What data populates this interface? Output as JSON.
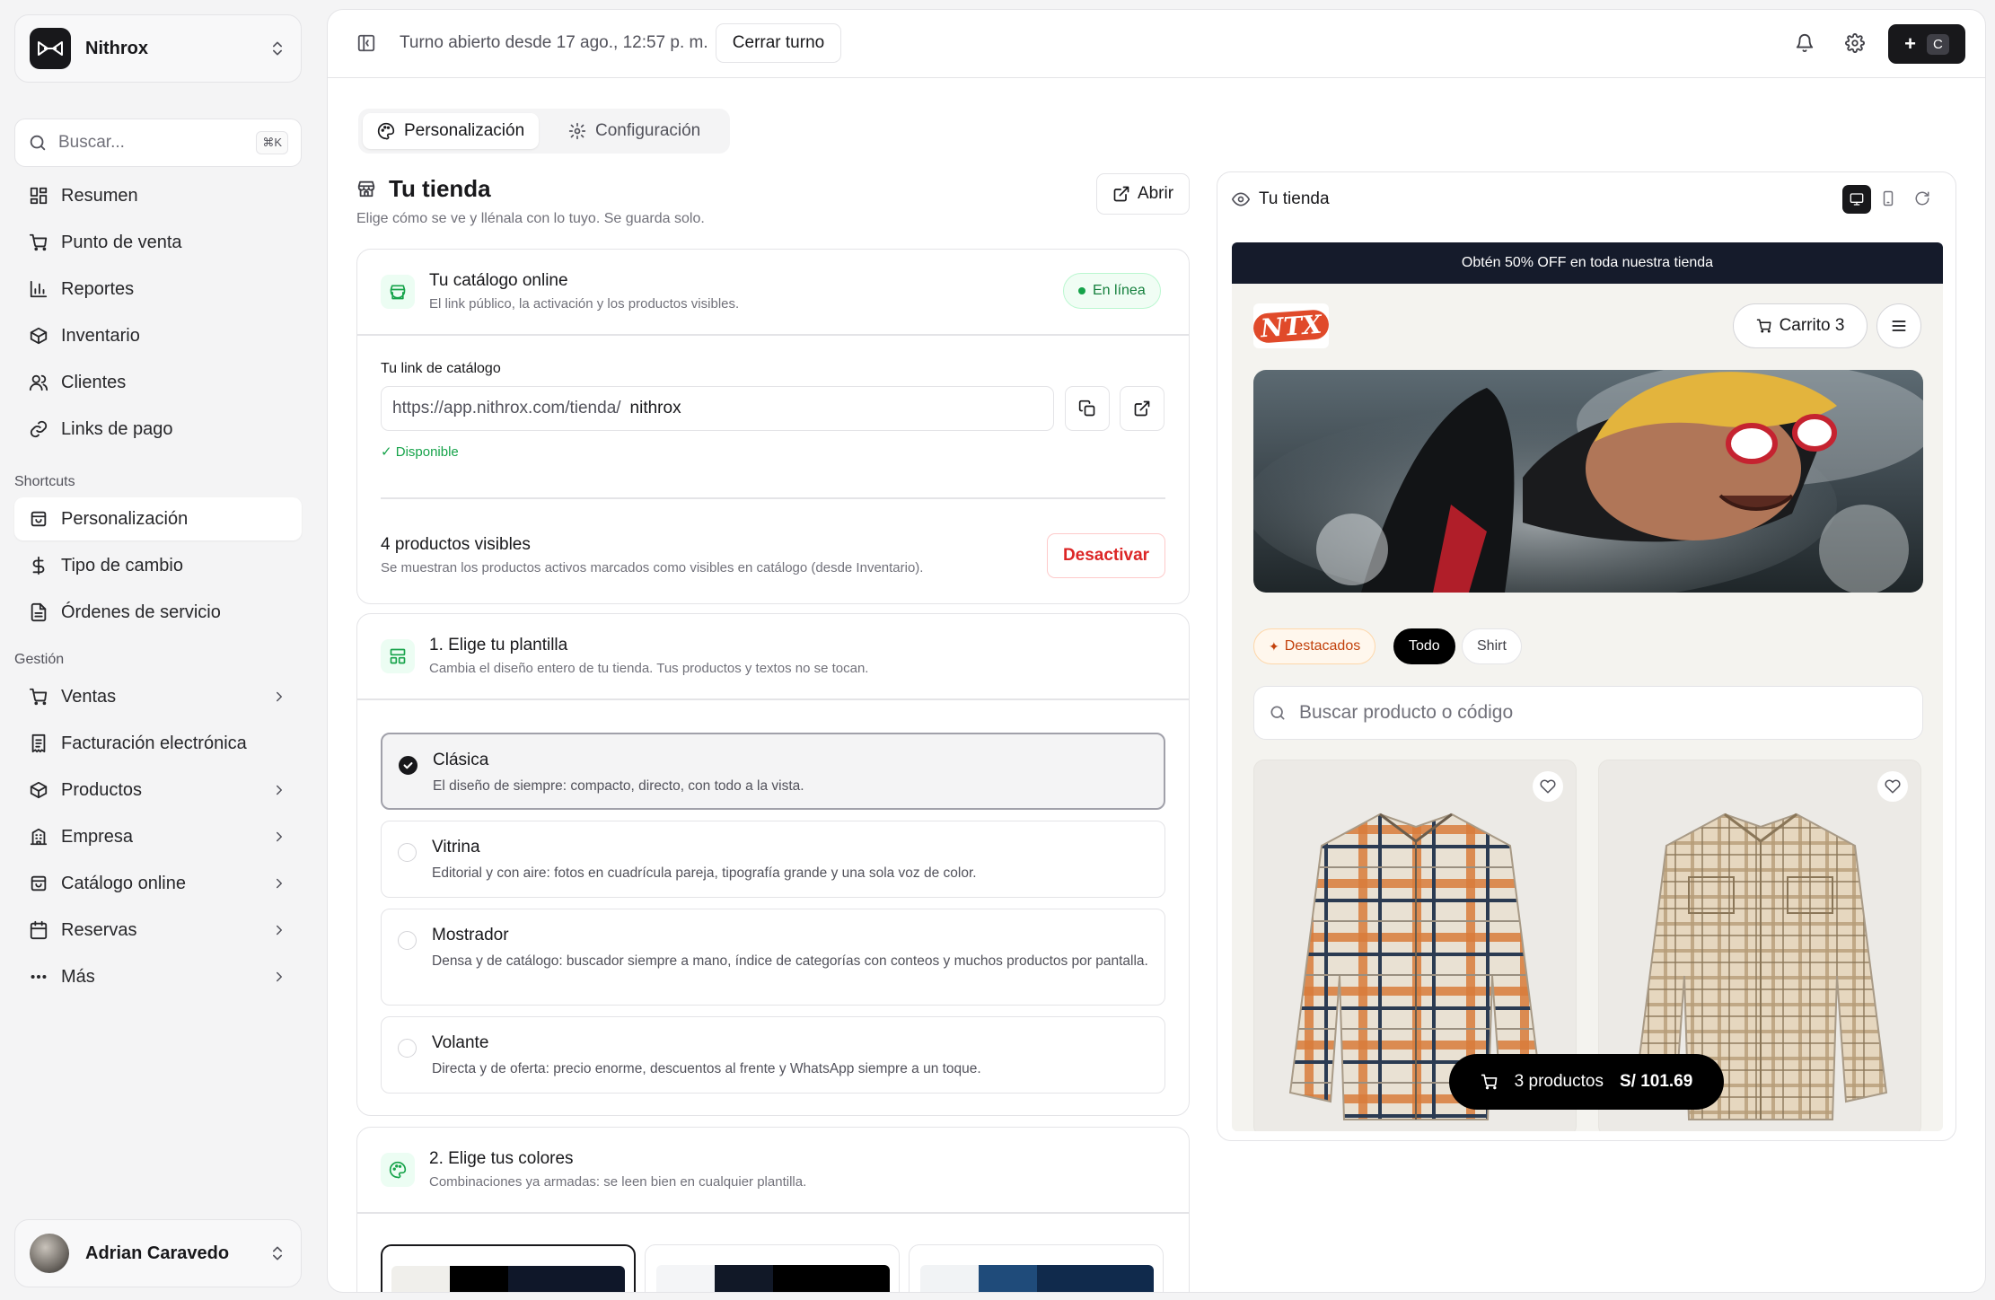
{
  "org": {
    "name": "Nithrox"
  },
  "search": {
    "placeholder": "Buscar...",
    "shortcut": "⌘K"
  },
  "nav": {
    "main": [
      {
        "label": "Resumen",
        "icon": "grid-icon"
      },
      {
        "label": "Punto de venta",
        "icon": "cart-icon"
      },
      {
        "label": "Reportes",
        "icon": "bar-chart-icon"
      },
      {
        "label": "Inventario",
        "icon": "box-icon"
      },
      {
        "label": "Clientes",
        "icon": "users-icon"
      },
      {
        "label": "Links de pago",
        "icon": "link-icon"
      }
    ],
    "shortcuts_title": "Shortcuts",
    "shortcuts": [
      {
        "label": "Personalización",
        "icon": "store-icon"
      },
      {
        "label": "Tipo de cambio",
        "icon": "dollar-icon"
      },
      {
        "label": "Órdenes de servicio",
        "icon": "document-icon"
      }
    ],
    "gestion_title": "Gestión",
    "gestion": [
      {
        "label": "Ventas",
        "icon": "cart-icon"
      },
      {
        "label": "Facturación electrónica",
        "icon": "receipt-icon"
      },
      {
        "label": "Productos",
        "icon": "box-icon"
      },
      {
        "label": "Empresa",
        "icon": "building-icon"
      },
      {
        "label": "Catálogo online",
        "icon": "store-icon"
      },
      {
        "label": "Reservas",
        "icon": "calendar-icon"
      },
      {
        "label": "Más",
        "icon": "dots-icon"
      }
    ]
  },
  "user": {
    "name": "Adrian Caravedo"
  },
  "topbar": {
    "shift_text": "Turno abierto desde 17 ago., 12:57 p. m.",
    "close_shift": "Cerrar turno",
    "new_button": "+",
    "new_shortcut": "C"
  },
  "tabs": [
    {
      "label": "Personalización"
    },
    {
      "label": "Configuración"
    }
  ],
  "store": {
    "title": "Tu tienda",
    "subtitle": "Elige cómo se ve y llénala con lo tuyo. Se guarda solo.",
    "open_button": "Abrir"
  },
  "catalog": {
    "title": "Tu catálogo online",
    "subtitle": "El link público, la activación y los productos visibles.",
    "status": "En línea",
    "link_label": "Tu link de catálogo",
    "link_prefix": "https://app.nithrox.com/tienda/",
    "link_slug": "nithrox",
    "availability": "✓ Disponible",
    "visible_title": "4 productos visibles",
    "visible_desc": "Se muestran los productos activos marcados como visibles en catálogo (desde Inventario).",
    "deactivate": "Desactivar"
  },
  "template": {
    "title": "1. Elige tu plantilla",
    "subtitle": "Cambia el diseño entero de tu tienda. Tus productos y textos no se tocan.",
    "options": [
      {
        "name": "Clásica",
        "desc": "El diseño de siempre: compacto, directo, con todo a la vista.",
        "selected": true
      },
      {
        "name": "Vitrina",
        "desc": "Editorial y con aire: fotos en cuadrícula pareja, tipografía grande y una sola voz de color.",
        "selected": false
      },
      {
        "name": "Mostrador",
        "desc": "Densa y de catálogo: buscador siempre a mano, índice de categorías con conteos y muchos productos por pantalla.",
        "selected": false
      },
      {
        "name": "Volante",
        "desc": "Directa y de oferta: precio enorme, descuentos al frente y WhatsApp siempre a un toque.",
        "selected": false
      }
    ]
  },
  "colors": {
    "title": "2. Elige tus colores",
    "subtitle": "Combinaciones ya armadas: se leen bien en cualquier plantilla.",
    "palettes": [
      {
        "swatches": [
          "#f0efeb",
          "#000000",
          "#0f1729"
        ],
        "selected": true
      },
      {
        "swatches": [
          "#f4f5f7",
          "#111827",
          "#000000"
        ],
        "selected": false
      },
      {
        "swatches": [
          "#f1f3f5",
          "#1f4b7a",
          "#102a4c"
        ],
        "selected": false
      }
    ]
  },
  "preview": {
    "title": "Tu tienda",
    "promo": "Obtén 50% OFF en toda nuestra tienda",
    "logo": "NTX",
    "cart_label": "Carrito 3",
    "chips": [
      "Destacados",
      "Todo",
      "Shirt"
    ],
    "search_placeholder": "Buscar producto o código",
    "cart_bar_count": "3 productos",
    "cart_bar_total": "S/ 101.69"
  },
  "colors_ui": {
    "accent": "#18181b",
    "success": "#16a34a",
    "danger": "#dc2626",
    "promo_bg": "#151b2b"
  }
}
